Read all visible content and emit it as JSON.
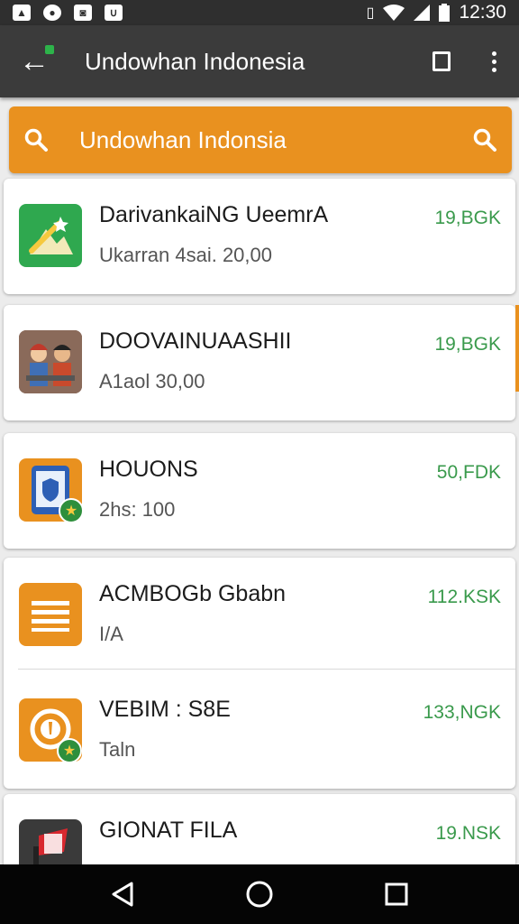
{
  "status_bar": {
    "time": "12:30",
    "icons": [
      "notification-icon",
      "whatsapp-icon",
      "gallery-icon",
      "download-icon",
      "vibrate-icon",
      "wifi-icon",
      "signal-icon",
      "battery-icon"
    ]
  },
  "app_bar": {
    "title": "Undowhan Indonesia",
    "back_icon": "back-arrow-icon",
    "overview_icon": "square-icon",
    "menu_icon": "more-vert-icon"
  },
  "search": {
    "text": "Undowhan Indonsia",
    "icon": "search-icon"
  },
  "items": [
    {
      "name": "DarivankaiNG UeemrA",
      "subtitle": "Ukarran 4sai. 20,00",
      "size": "19,BGK",
      "icon": "mountain-icon",
      "icon_color": "#2fa84f"
    },
    {
      "name": "DOOVAINUAASHII",
      "subtitle": "A1aol 30,00",
      "size": "19,BGK",
      "icon": "people-icon",
      "icon_color": "#c65a3a"
    },
    {
      "name": "HOUONS",
      "subtitle": "2hs: 100",
      "size": "50,FDK",
      "icon": "tablet-icon",
      "icon_color": "#e9911f"
    },
    {
      "name": "ACMBOGb Gbabn",
      "subtitle": "I/A",
      "size": "112.KSK",
      "icon": "list-icon",
      "icon_color": "#e9911f"
    },
    {
      "name": "VEBIM : S8E",
      "subtitle": "Taln",
      "size": "133,NGK",
      "icon": "coin-icon",
      "icon_color": "#e9911f"
    },
    {
      "name": "GIONAT FILA",
      "subtitle": "",
      "size": "19.NSK",
      "icon": "flag-icon",
      "icon_color": "#3a3a3a"
    }
  ],
  "nav": {
    "back_icon": "nav-back-icon",
    "home_icon": "nav-home-icon",
    "recents_icon": "nav-recents-icon"
  },
  "colors": {
    "accent": "#e9911f",
    "app_bar": "#3b3b3b",
    "size_text": "#3a9a4c",
    "icon_green": "#2fa84f"
  }
}
